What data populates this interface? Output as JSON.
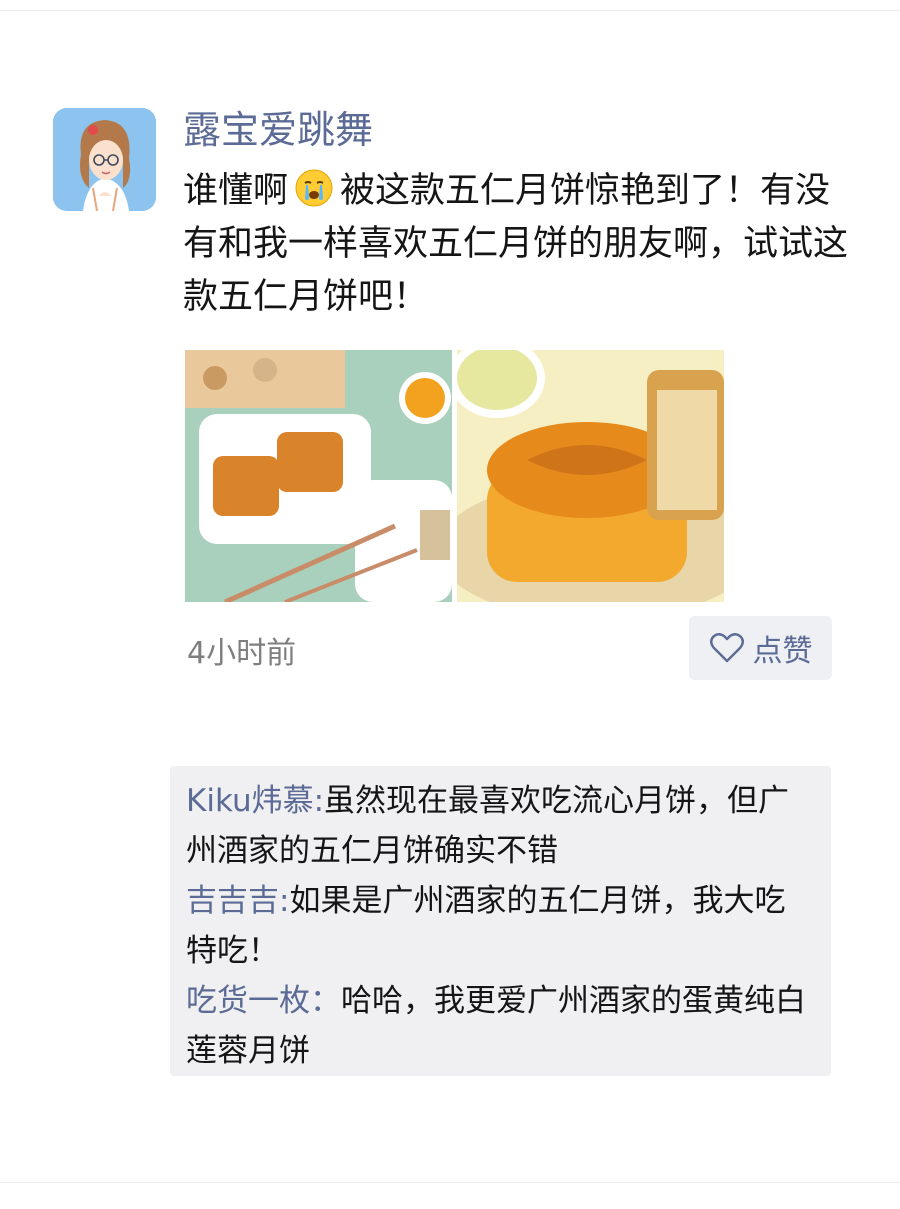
{
  "post": {
    "username": "露宝爱跳舞",
    "text_before_emoji": "谁懂啊",
    "emoji": "crying-face-emoji",
    "text_after_emoji": "被这款五仁月饼惊艳到了！有没有和我一样喜欢五仁月饼的朋友啊，试试这款五仁月饼吧！",
    "timestamp": "4小时前",
    "like_label": "点赞",
    "photos": [
      "mooncake-plate-photo",
      "mooncake-closeup-photo"
    ]
  },
  "comments": [
    {
      "author": "Kiku炜慕",
      "separator": ":",
      "text": "虽然现在最喜欢吃流心月饼，但广州酒家的五仁月饼确实不错"
    },
    {
      "author": "吉吉吉",
      "separator": ":",
      "text": "如果是广州酒家的五仁月饼，我大吃特吃！"
    },
    {
      "author": "吃货一枚",
      "separator": "：",
      "text": "哈哈，我更爱广州酒家的蛋黄纯白莲蓉月饼"
    }
  ],
  "colors": {
    "link": "#5b6b95",
    "text": "#151515",
    "muted": "#7e7e7e",
    "comment_bg": "#f0f0f2",
    "like_bg": "#eff0f4"
  }
}
